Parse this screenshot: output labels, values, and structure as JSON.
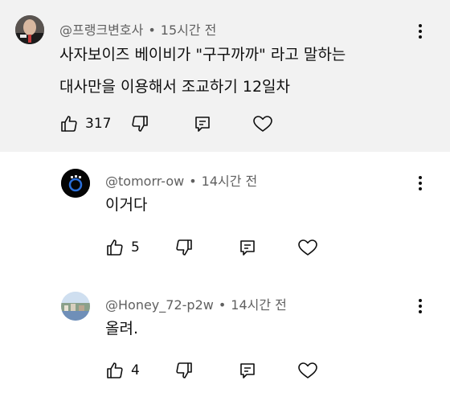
{
  "comments": [
    {
      "author": "@프랭크변호사",
      "time": "15시간 전",
      "text_lines": [
        "사자보이즈 베이비가 \"구구까까\" 라고 말하는",
        "대사만을 이용해서 조교하기 12일차"
      ],
      "likes": "317",
      "highlighted": true
    },
    {
      "author": "@tomorr-ow",
      "time": "14시간 전",
      "text_lines": [
        "이거다"
      ],
      "likes": "5",
      "highlighted": false
    },
    {
      "author": "@Honey_72-p2w",
      "time": "14시간 전",
      "text_lines": [
        "올려."
      ],
      "likes": "4",
      "highlighted": false
    }
  ],
  "separator": "•",
  "icons": {
    "like": "thumbs-up-icon",
    "dislike": "thumbs-down-icon",
    "reply": "reply-icon",
    "heart": "heart-icon",
    "more": "more-vertical-icon"
  },
  "colors": {
    "highlight_bg": "#f2f2f2",
    "meta_text": "#606060",
    "text": "#0f0f0f"
  }
}
